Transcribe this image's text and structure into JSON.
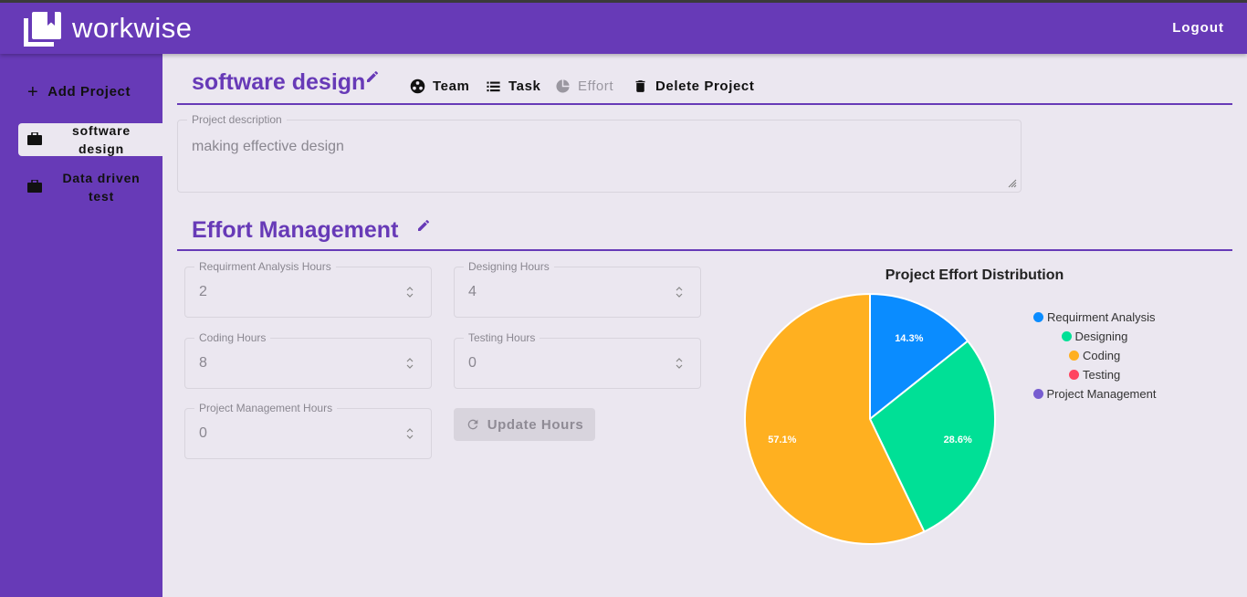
{
  "app": {
    "title": "workwise",
    "logout_label": "Logout"
  },
  "sidebar": {
    "add_label": "Add Project",
    "items": [
      {
        "label": "software design",
        "active": true
      },
      {
        "label": "Data driven test",
        "active": false
      }
    ]
  },
  "project": {
    "title": "software design",
    "tabs": [
      {
        "label": "Team",
        "icon": "team-icon"
      },
      {
        "label": "Task",
        "icon": "list-icon"
      },
      {
        "label": "Effort",
        "icon": "pie-chart-icon",
        "disabled": true
      },
      {
        "label": "Delete Project",
        "icon": "trash-icon"
      }
    ],
    "description_label": "Project description",
    "description_value": "making effective design"
  },
  "effort": {
    "title": "Effort Management",
    "fields": {
      "requirement": {
        "label": "Requirment Analysis Hours",
        "value": "2"
      },
      "designing": {
        "label": "Designing Hours",
        "value": "4"
      },
      "coding": {
        "label": "Coding Hours",
        "value": "8"
      },
      "testing": {
        "label": "Testing Hours",
        "value": "0"
      },
      "management": {
        "label": "Project Management Hours",
        "value": "0"
      }
    },
    "update_label": "Update Hours"
  },
  "colors": {
    "primary": "#673ab7",
    "background": "#ebe7f0"
  },
  "chart_data": {
    "type": "pie",
    "title": "Project Effort Distribution",
    "categories": [
      "Requirment Analysis",
      "Designing",
      "Coding",
      "Testing",
      "Project Management"
    ],
    "values": [
      2,
      4,
      8,
      0,
      0
    ],
    "percent_labels": [
      "14.3%",
      "28.6%",
      "57.1%",
      "",
      ""
    ],
    "colors": [
      "#0a8cff",
      "#00e096",
      "#ffb020",
      "#ff4560",
      "#775dd0"
    ],
    "legend_position": "right"
  }
}
